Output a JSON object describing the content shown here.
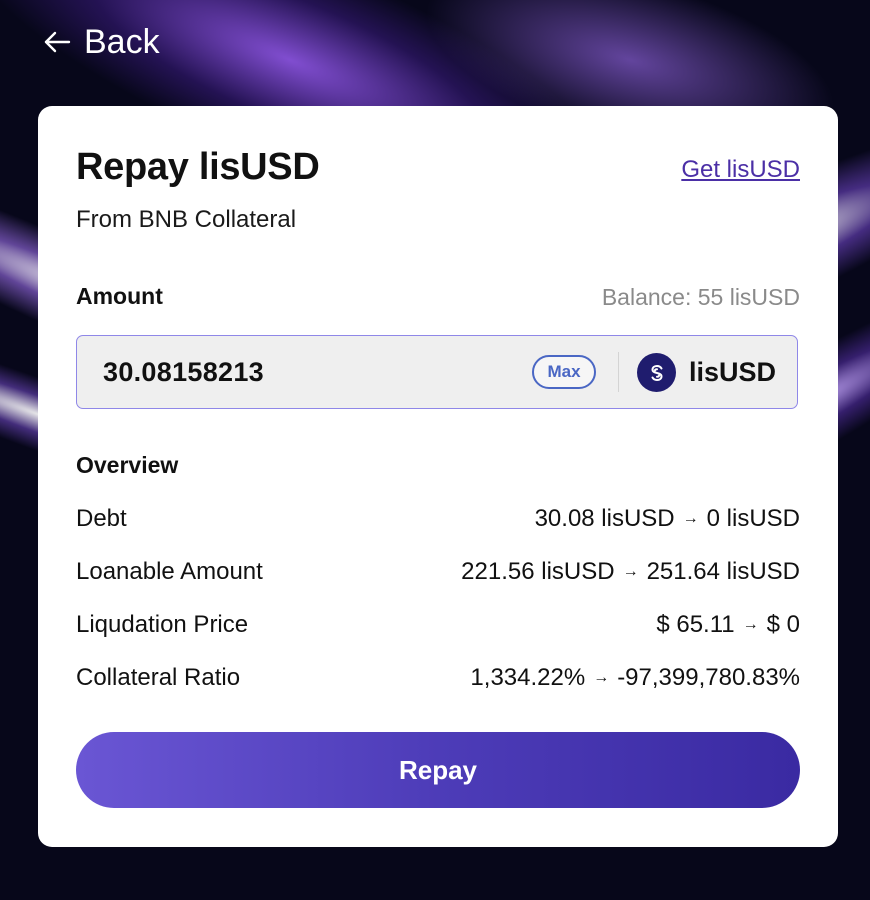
{
  "nav": {
    "back_label": "Back"
  },
  "card": {
    "title": "Repay lisUSD",
    "subtitle": "From BNB Collateral",
    "get_link": "Get lisUSD"
  },
  "amount": {
    "label": "Amount",
    "balance": "Balance: 55 lisUSD",
    "value": "30.08158213",
    "max_label": "Max",
    "token": "lisUSD"
  },
  "overview": {
    "label": "Overview",
    "rows": [
      {
        "label": "Debt",
        "from": "30.08 lisUSD",
        "to": "0 lisUSD"
      },
      {
        "label": "Loanable Amount",
        "from": "221.56 lisUSD",
        "to": "251.64 lisUSD"
      },
      {
        "label": "Liqudation Price",
        "from": "$ 65.11",
        "to": "$ 0"
      },
      {
        "label": "Collateral Ratio",
        "from": "1,334.22%",
        "to": "-97,399,780.83%"
      }
    ]
  },
  "repay_button": "Repay",
  "colors": {
    "accent": "#4d3cb8",
    "link": "#4b2fa6",
    "max_border": "#4a67c4",
    "token_icon_bg": "#1f1c6e"
  },
  "icons": {
    "back": "arrow-left-icon",
    "token": "lisusd-token-icon",
    "arrow": "arrow-right-icon"
  }
}
